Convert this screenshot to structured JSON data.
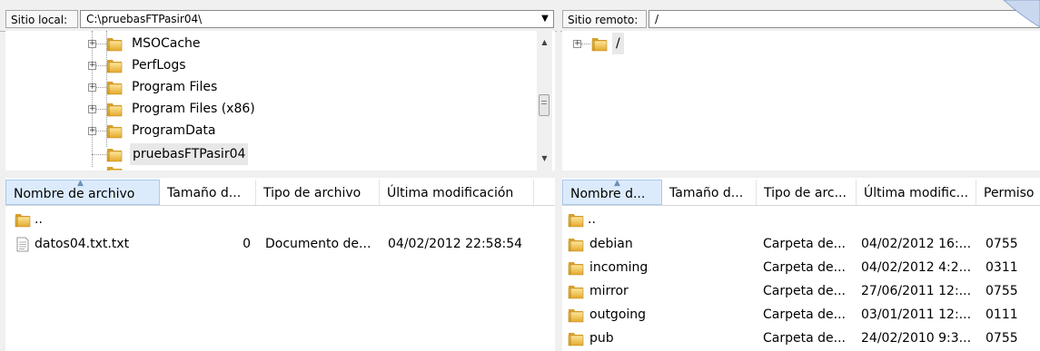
{
  "local": {
    "site_label": "Sitio local:",
    "path": "C:\\pruebasFTPasir04\\",
    "tree": [
      {
        "label": "MSOCache",
        "expander": "+"
      },
      {
        "label": "PerfLogs",
        "expander": "+"
      },
      {
        "label": "Program Files",
        "expander": "+"
      },
      {
        "label": "Program Files (x86)",
        "expander": "+"
      },
      {
        "label": "ProgramData",
        "expander": "+"
      },
      {
        "label": "pruebasFTPasir04",
        "expander": ""
      }
    ],
    "columns": [
      "Nombre de archivo",
      "Tamaño d...",
      "Tipo de archivo",
      "Última modificación"
    ],
    "files": [
      {
        "name": "..",
        "size": "",
        "type": "",
        "modified": "",
        "icon": "folder-icon"
      },
      {
        "name": "datos04.txt.txt",
        "size": "0",
        "type": "Documento de...",
        "modified": "04/02/2012 22:58:54",
        "icon": "text-file-icon"
      }
    ]
  },
  "remote": {
    "site_label": "Sitio remoto:",
    "path": "/",
    "tree": [
      {
        "label": "/",
        "expander": "+"
      }
    ],
    "columns": [
      "Nombre d...",
      "Tamaño d...",
      "Tipo de arc...",
      "Última modific...",
      "Permiso"
    ],
    "files": [
      {
        "name": "..",
        "size": "",
        "type": "",
        "modified": "",
        "perms": ""
      },
      {
        "name": "debian",
        "size": "",
        "type": "Carpeta de...",
        "modified": "04/02/2012 16:...",
        "perms": "0755"
      },
      {
        "name": "incoming",
        "size": "",
        "type": "Carpeta de...",
        "modified": "04/02/2012 4:2...",
        "perms": "0311"
      },
      {
        "name": "mirror",
        "size": "",
        "type": "Carpeta de...",
        "modified": "27/06/2011 12:...",
        "perms": "0755"
      },
      {
        "name": "outgoing",
        "size": "",
        "type": "Carpeta de...",
        "modified": "03/01/2011 12:...",
        "perms": "0111"
      },
      {
        "name": "pub",
        "size": "",
        "type": "Carpeta de...",
        "modified": "24/02/2010 9:3...",
        "perms": "0755"
      }
    ]
  },
  "colors": {
    "folder": "#e8b93a",
    "header_active": "#dcebfc",
    "selection": "#e8e8e8"
  }
}
